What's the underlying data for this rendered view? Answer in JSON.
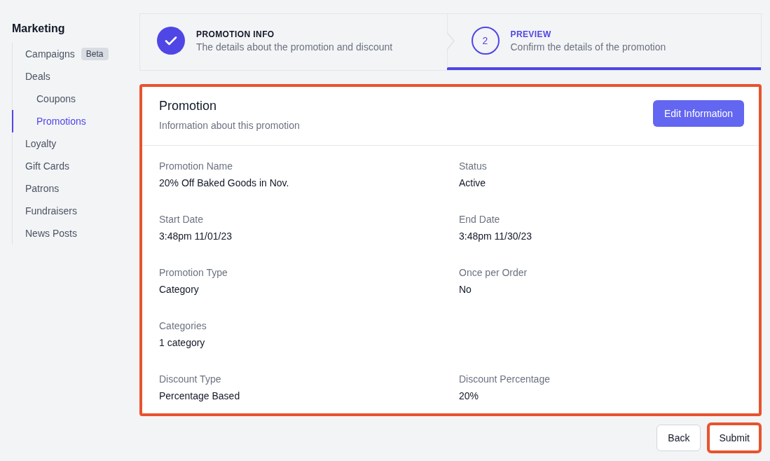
{
  "sidebar": {
    "title": "Marketing",
    "items": [
      {
        "label": "Campaigns",
        "badge": "Beta",
        "selected": false
      },
      {
        "label": "Deals",
        "selected": false,
        "children": [
          {
            "label": "Coupons",
            "selected": false
          },
          {
            "label": "Promotions",
            "selected": true
          }
        ]
      },
      {
        "label": "Loyalty",
        "selected": false
      },
      {
        "label": "Gift Cards",
        "selected": false
      },
      {
        "label": "Patrons",
        "selected": false
      },
      {
        "label": "Fundraisers",
        "selected": false
      },
      {
        "label": "News Posts",
        "selected": false
      }
    ]
  },
  "steps": [
    {
      "completed": true,
      "current": false,
      "title": "PROMOTION INFO",
      "description": "The details about the promotion and discount"
    },
    {
      "completed": false,
      "current": true,
      "number": "2",
      "title": "PREVIEW",
      "description": "Confirm the details of the promotion"
    }
  ],
  "card": {
    "highlighted": true,
    "title": "Promotion",
    "subtitle": "Information about this promotion",
    "action": "Edit Information",
    "rows": [
      [
        {
          "label": "Promotion Name",
          "value": "20% Off Baked Goods in Nov."
        },
        {
          "label": "Status",
          "value": "Active"
        }
      ],
      [
        {
          "label": "Start Date",
          "value": "3:48pm 11/01/23"
        },
        {
          "label": "End Date",
          "value": "3:48pm 11/30/23"
        }
      ],
      [
        {
          "label": "Promotion Type",
          "value": "Category"
        },
        {
          "label": "Once per Order",
          "value": "No"
        }
      ],
      [
        {
          "label": "Categories",
          "value": "1 category"
        }
      ],
      [
        {
          "label": "Discount Type",
          "value": "Percentage Based"
        },
        {
          "label": "Discount Percentage",
          "value": "20%"
        }
      ]
    ]
  },
  "buttons": [
    {
      "label": "Back",
      "highlighted": false
    },
    {
      "label": "Submit",
      "highlighted": true
    }
  ]
}
